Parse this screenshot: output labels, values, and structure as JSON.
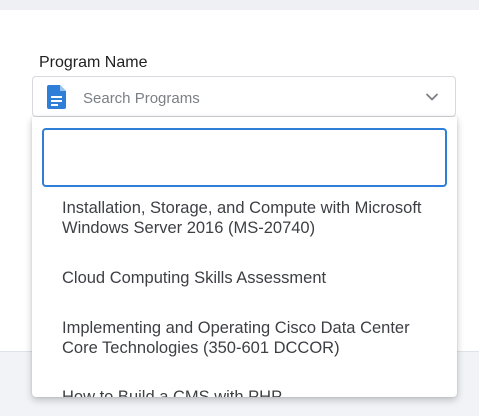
{
  "field": {
    "label": "Program Name",
    "placeholder": "Search Programs"
  },
  "dropdown": {
    "search_value": "",
    "options": [
      "Installation, Storage, and Compute with Microsoft Windows Server 2016 (MS-20740)",
      "Cloud Computing Skills Assessment",
      "Implementing and Operating Cisco Data Center Core Technologies (350-601 DCCOR)",
      "How to Build a CMS with PHP"
    ]
  },
  "colors": {
    "accent": "#2f7fd8",
    "icon": "#2f7fd8"
  },
  "icons": {
    "field_icon": "document-icon",
    "toggle_icon": "chevron-down-icon"
  }
}
